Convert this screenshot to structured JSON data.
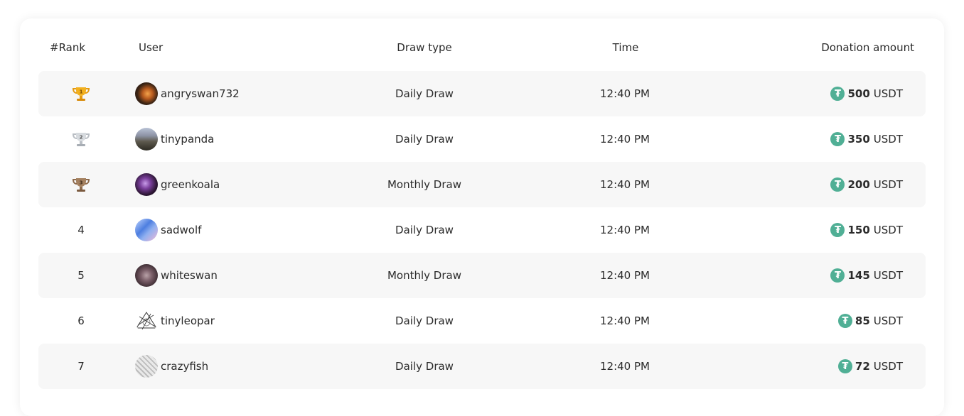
{
  "header": {
    "rank": "#Rank",
    "user": "User",
    "draw_type": "Draw type",
    "time": "Time",
    "donation_amount": "Donation amount"
  },
  "rows": [
    {
      "rank": "1",
      "rank_icon": "gold-trophy-icon",
      "user": "angryswan732",
      "draw_type": "Daily Draw",
      "time": "12:40 PM",
      "amount": "500",
      "currency": "USDT"
    },
    {
      "rank": "2",
      "rank_icon": "silver-trophy-icon",
      "user": "tinypanda",
      "draw_type": "Daily Draw",
      "time": "12:40 PM",
      "amount": "350",
      "currency": "USDT"
    },
    {
      "rank": "3",
      "rank_icon": "bronze-trophy-icon",
      "user": "greenkoala",
      "draw_type": "Monthly Draw",
      "time": "12:40 PM",
      "amount": "200",
      "currency": "USDT"
    },
    {
      "rank": "4",
      "user": "sadwolf",
      "draw_type": "Daily Draw",
      "time": "12:40 PM",
      "amount": "150",
      "currency": "USDT"
    },
    {
      "rank": "5",
      "user": "whiteswan",
      "draw_type": "Monthly Draw",
      "time": "12:40 PM",
      "amount": "145",
      "currency": "USDT"
    },
    {
      "rank": "6",
      "user": "tinyleopar",
      "draw_type": "Daily Draw",
      "time": "12:40 PM",
      "amount": "85",
      "currency": "USDT"
    },
    {
      "rank": "7",
      "user": "crazyfish",
      "draw_type": "Daily Draw",
      "time": "12:40 PM",
      "amount": "72",
      "currency": "USDT"
    }
  ],
  "icons": {
    "coin": "tether-coin-icon",
    "coin_symbol": "₮"
  },
  "colors": {
    "tether_green": "#50af95",
    "gold": "#f2b01e",
    "silver": "#cfd3d8",
    "bronze": "#a4805f",
    "row_shade": "#f7f7f7"
  }
}
